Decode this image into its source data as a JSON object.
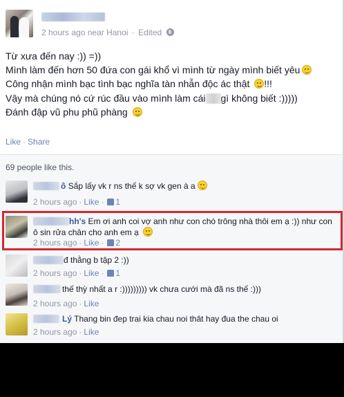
{
  "post": {
    "meta": {
      "time": "2 hours ago",
      "location": "near Hanoi",
      "edited": "Edited",
      "sep": "·"
    },
    "lines": [
      "Từ xưa đến nay :)) =))",
      "Mình làm đến hơn 50 đứa con gái khổ vì mình từ ngày mình biết yêu",
      "Công nhận mình bạc tình bạc nghĩa tàn nhẫn độc ác thật",
      "!!!",
      "Vậy mà chúng nó cứ rúc đầu vào mình làm cái",
      "gì không biết :)))))",
      "Đánh đập vũ phu phũ phàng"
    ],
    "actions": {
      "like": "Like",
      "sep": "·",
      "share": "Share"
    },
    "likes_text": "69 people like this."
  },
  "comments": [
    {
      "name_suffix": "ô",
      "text": "Sắp lấy vk r ns thế k sợ vk gen à a",
      "time": "2 hours ago",
      "like": "Like",
      "count": "1"
    },
    {
      "name_suffix": "hh's",
      "text": "Em ơi anh coi vợ anh như con chó trông nhà thôi em ạ :)) như con ô sin rửa chân cho anh em ạ",
      "time": "2 hours ago",
      "like": "Like",
      "count": "2"
    },
    {
      "name_suffix": "",
      "text": "đ thằng b tập 2 :))",
      "time": "2 hours ago",
      "like": "Like",
      "count": "1"
    },
    {
      "name_suffix": "",
      "text": "thế thỳ nhất a r :))))))))) vk chưa cưới mà đã ns thế :)))",
      "time": "2 hours ago",
      "like": "Like",
      "count": ""
    },
    {
      "name_suffix": "Lý",
      "text": "Thang bin đep trai kia chau noi thât hay đua the chau oi",
      "time": "2 hours ago",
      "like": "Like",
      "count": ""
    }
  ],
  "colors": {
    "link": "#3b5998",
    "meta": "#9197a3",
    "highlight": "#d6262c",
    "panel": "#f6f7f9"
  },
  "icons": [
    "globe-icon",
    "emoticon-icon",
    "thumbs-up-icon"
  ]
}
